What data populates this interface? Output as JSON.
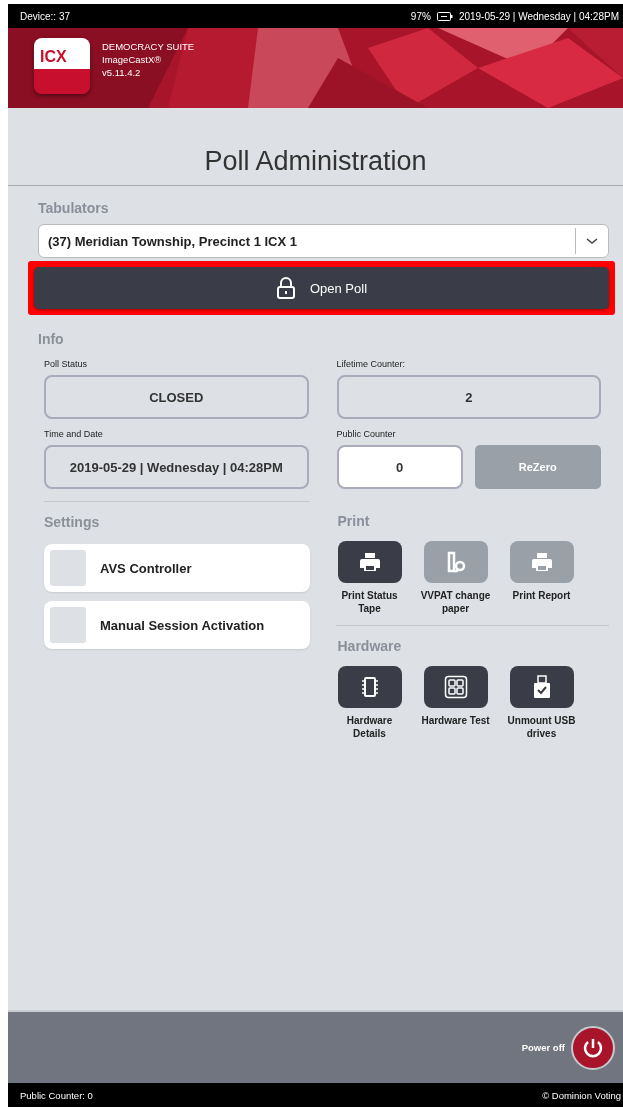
{
  "status_bar": {
    "device": "Device:: 37",
    "battery": "97%",
    "datetime": "2019-05-29 | Wednesday | 04:28PM"
  },
  "header": {
    "logo": "ICX",
    "suite": "DEMOCRACY SUITE",
    "product": "ImageCastX®",
    "version": "v5.11.4.2"
  },
  "title": "Poll Administration",
  "tabulators": {
    "label": "Tabulators",
    "value": "(37) Meridian Township, Precinct 1 ICX 1"
  },
  "open_poll": {
    "label": "Open Poll",
    "highlighted": true
  },
  "info": {
    "heading": "Info",
    "fields": [
      {
        "label": "Poll Status",
        "value": "CLOSED",
        "kind": "display"
      },
      {
        "label": "Lifetime Counter:",
        "value": "2",
        "kind": "display"
      },
      {
        "label": "Time and Date",
        "value": "2019-05-29 | Wednesday | 04:28PM",
        "kind": "display"
      },
      {
        "label": "Public Counter",
        "value": "0",
        "kind": "counter",
        "button": {
          "label": "ReZero",
          "disabled": true
        }
      }
    ]
  },
  "settings": {
    "heading": "Settings",
    "items": [
      {
        "label": "AVS Controller",
        "checked": false
      },
      {
        "label": "Manual Session Activation",
        "checked": false
      }
    ]
  },
  "print": {
    "heading": "Print",
    "buttons": [
      {
        "label": "Print Status Tape",
        "kind": "printer",
        "disabled": false
      },
      {
        "label": "VVPAT change paper",
        "kind": "paper",
        "disabled": true
      },
      {
        "label": "Print Report",
        "kind": "printer",
        "disabled": true
      }
    ]
  },
  "hardware": {
    "heading": "Hardware",
    "buttons": [
      {
        "label": "Hardware Details",
        "kind": "chip",
        "disabled": false
      },
      {
        "label": "Hardware Test",
        "kind": "grid",
        "disabled": false
      },
      {
        "label": "Unmount USB drives",
        "kind": "usb",
        "disabled": false
      }
    ]
  },
  "footer": {
    "power": "Power off",
    "public_counter": "Public Counter: 0",
    "copyright": "© Dominion Voting"
  }
}
